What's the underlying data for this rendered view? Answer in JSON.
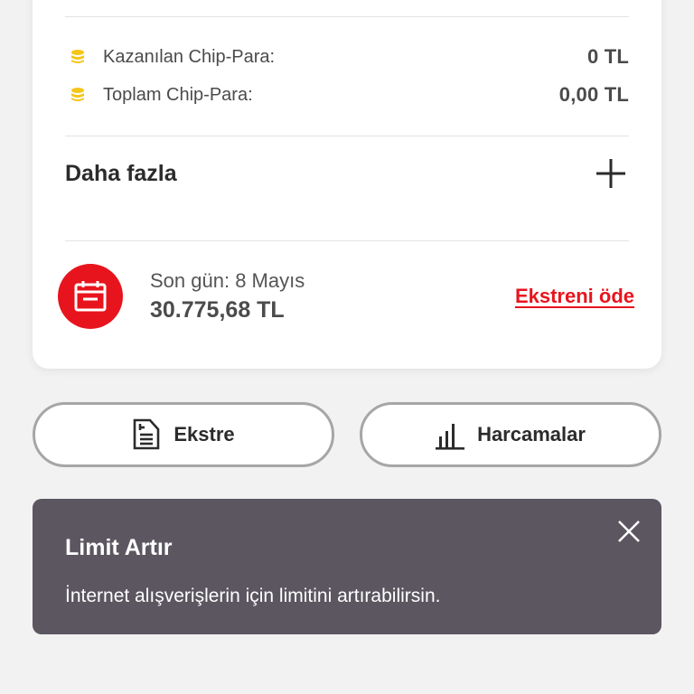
{
  "chips": {
    "earned_label": "Kazanılan Chip-Para:",
    "earned_value": "0 TL",
    "total_label": "Toplam Chip-Para:",
    "total_value": "0,00 TL",
    "icon": "coin-stack-icon",
    "icon_color": "#f5c518"
  },
  "more": {
    "label": "Daha fazla",
    "icon": "plus-icon"
  },
  "due": {
    "label": "Son gün: 8 Mayıs",
    "amount": "30.775,68 TL",
    "pay_label": "Ekstreni öde",
    "icon": "calendar-icon",
    "accent_color": "#e8141d"
  },
  "actions": {
    "statement_label": "Ekstre",
    "statement_icon": "document-list-icon",
    "spending_label": "Harcamalar",
    "spending_icon": "bar-chart-icon"
  },
  "banner": {
    "title": "Limit Artır",
    "text": "İnternet alışverişlerin için limitini artırabilirsin.",
    "close_icon": "close-icon",
    "background_color": "#5b5660"
  }
}
